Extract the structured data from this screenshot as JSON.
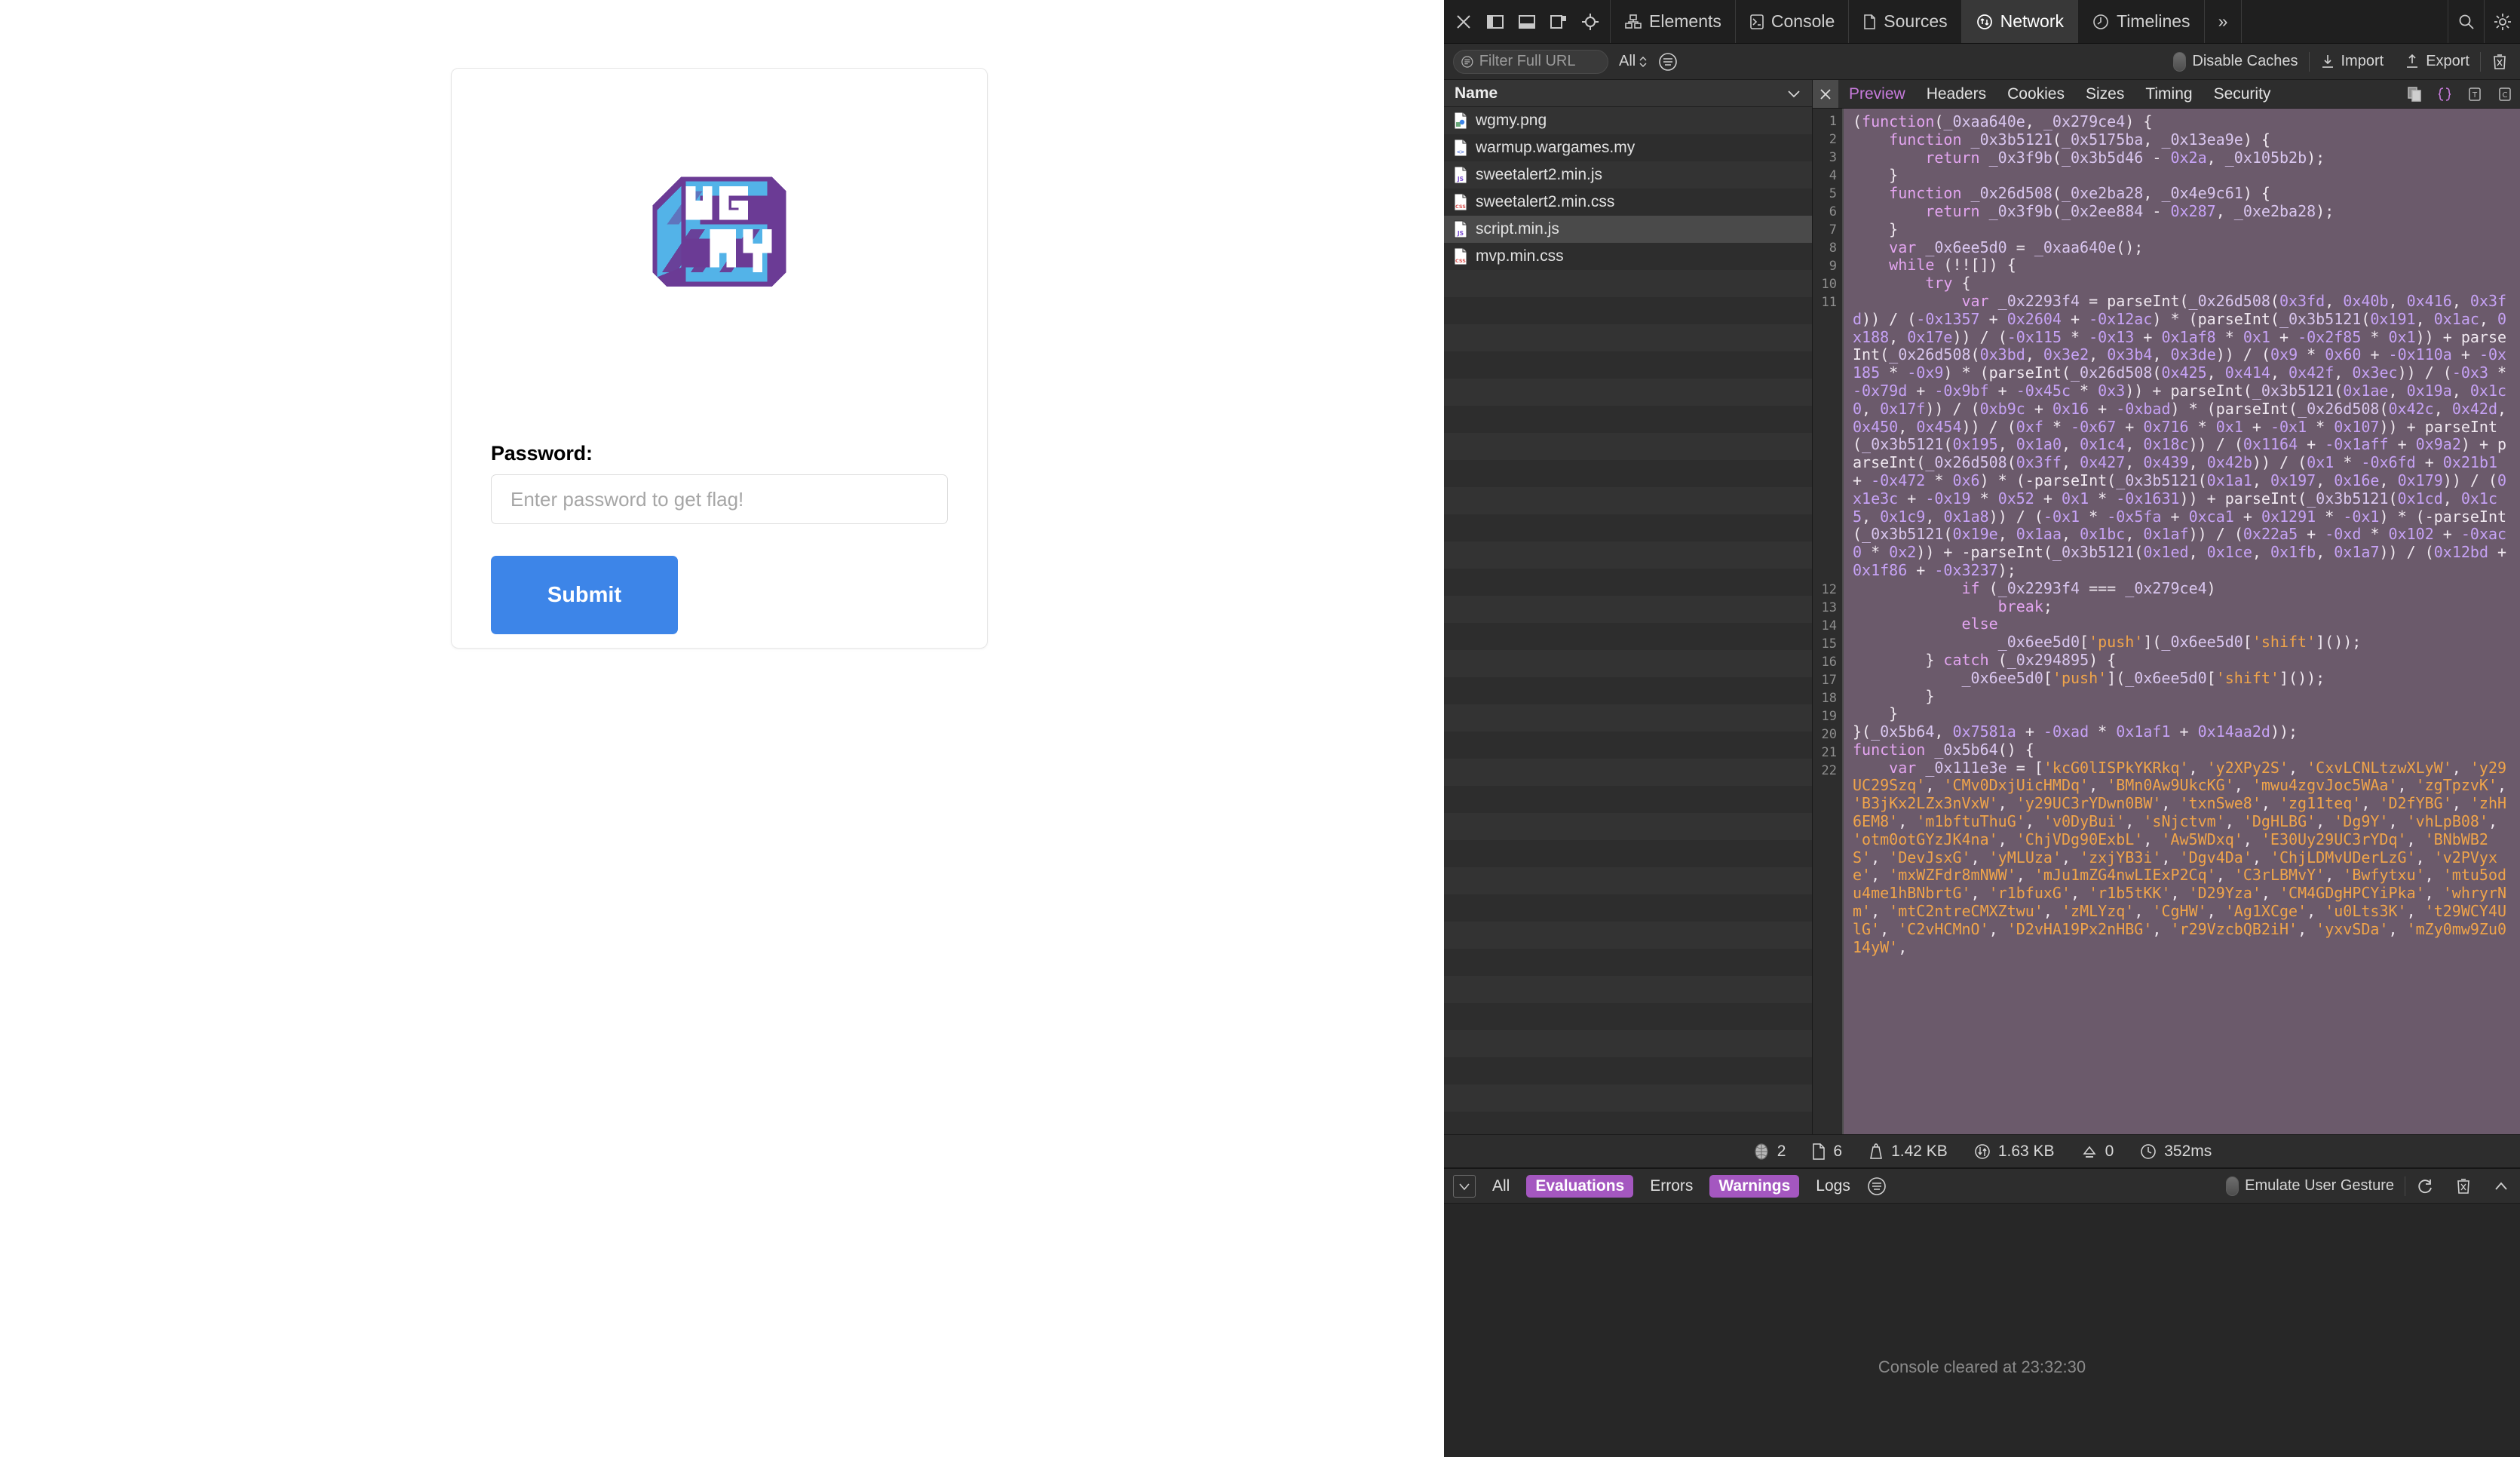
{
  "page": {
    "logo_alt": "WGMY",
    "password_label": "Password:",
    "password_placeholder": "Enter password to get flag!",
    "password_value": "",
    "submit_label": "Submit",
    "colors": {
      "submit_bg": "#3d85e8",
      "logo_blue": "#53b3e8",
      "logo_purple": "#6b3b95"
    }
  },
  "devtools": {
    "toolbar_icons": [
      "close-icon",
      "dock-left-icon",
      "dock-bottom-icon",
      "undock-icon",
      "inspect-icon"
    ],
    "tabs": [
      {
        "label": "Elements",
        "icon": "elements-icon",
        "active": false
      },
      {
        "label": "Console",
        "icon": "console-icon",
        "active": false
      },
      {
        "label": "Sources",
        "icon": "sources-icon",
        "active": false
      },
      {
        "label": "Network",
        "icon": "network-icon",
        "active": true
      },
      {
        "label": "Timelines",
        "icon": "timelines-icon",
        "active": false
      }
    ],
    "tabs_overflow": "»",
    "right_icons": [
      "search-icon",
      "settings-gear-icon"
    ],
    "filterbar": {
      "filter_placeholder": "Filter Full URL",
      "filter_value": "",
      "resource_type": "All",
      "more_filters_icon": "hamburger-circle-icon",
      "disable_caches_label": "Disable Caches",
      "disable_caches_on": false,
      "import_label": "Import",
      "export_label": "Export",
      "clear_icon": "trash-icon"
    },
    "filelist": {
      "header": "Name",
      "sort_icon": "chevron-down-icon",
      "rows": [
        {
          "name": "wgmy.png",
          "type": "png",
          "selected": false
        },
        {
          "name": "warmup.wargames.my",
          "type": "html",
          "selected": false
        },
        {
          "name": "sweetalert2.min.js",
          "type": "js",
          "selected": false
        },
        {
          "name": "sweetalert2.min.css",
          "type": "css",
          "selected": false
        },
        {
          "name": "script.min.js",
          "type": "js",
          "selected": true
        },
        {
          "name": "mvp.min.css",
          "type": "css",
          "selected": false
        }
      ]
    },
    "detail": {
      "close_icon": "close-icon",
      "tabs": [
        {
          "label": "Preview",
          "active": true
        },
        {
          "label": "Headers",
          "active": false
        },
        {
          "label": "Cookies",
          "active": false
        },
        {
          "label": "Sizes",
          "active": false
        },
        {
          "label": "Timing",
          "active": false
        },
        {
          "label": "Security",
          "active": false
        }
      ],
      "action_icons": [
        "copy-icon",
        "pretty-print-braces-icon",
        "show-text-icon",
        "show-chars-icon"
      ]
    },
    "code": {
      "line_numbers": [
        1,
        2,
        3,
        4,
        5,
        6,
        7,
        8,
        9,
        10,
        11,
        12,
        13,
        14,
        15,
        16,
        17,
        18,
        19,
        20,
        21,
        22
      ],
      "lines": [
        "(function(_0xaa640e, _0x279ce4) {",
        "    function _0x3b5121(_0x5175ba, _0x13ea9e) {",
        "        return _0x3f9b(_0x3b5d46 - 0x2a, _0x105b2b);",
        "    }",
        "    function _0x26d508(_0xe2ba28, _0x4e9c61) {",
        "        return _0x3f9b(_0x2ee884 - 0x287, _0xe2ba28);",
        "    }",
        "    var _0x6ee5d0 = _0xaa640e();",
        "    while (!![]) {",
        "        try {",
        "            var _0x2293f4 = parseInt(_0x26d508(0x3fd, 0x40b, 0x416, 0x3fd)) / (-0x1357 + 0x2604 + -0x12ac) * (parseInt(_0x3b5121(0x191, 0x1ac, 0x188, 0x17e)) / (-0x115 * -0x13 + 0x1af8 * 0x1 + -0x2f85 * 0x1)) + parseInt(_0x26d508(0x3bd, 0x3e2, 0x3b4, 0x3de)) / (0x9 * 0x60 + -0x110a + -0x185 * -0x9) * (parseInt(_0x26d508(0x425, 0x414, 0x42f, 0x3ec)) / (-0x3 * -0x79d + -0x9bf + -0x45c * 0x3)) + parseInt(_0x3b5121(0x1ae, 0x19a, 0x1c0, 0x17f)) / (0xb9c + 0x16 + -0xbad) * (parseInt(_0x26d508(0x42c, 0x42d, 0x450, 0x454)) / (0xf * -0x67 + 0x716 * 0x1 + -0x1 * 0x107)) + parseInt(_0x3b5121(0x195, 0x1a0, 0x1c4, 0x18c)) / (0x1164 + -0x1aff + 0x9a2) + parseInt(_0x26d508(0x3ff, 0x427, 0x439, 0x42b)) / (0x1 * -0x6fd + 0x21b1 + -0x472 * 0x6) * (-parseInt(_0x3b5121(0x1a1, 0x197, 0x16e, 0x179)) / (0x1e3c + -0x19 * 0x52 + 0x1 * -0x1631)) + parseInt(_0x3b5121(0x1cd, 0x1c5, 0x1c9, 0x1a8)) / (-0x1 * -0x5fa + 0xca1 + 0x1291 * -0x1) * (-parseInt(_0x3b5121(0x19e, 0x1aa, 0x1bc, 0x1af)) / (0x22a5 + -0xd * 0x102 + -0xac0 * 0x2)) + -parseInt(_0x3b5121(0x1ed, 0x1ce, 0x1fb, 0x1a7)) / (0x12bd + 0x1f86 + -0x3237);",
        "            if (_0x2293f4 === _0x279ce4)",
        "                break;",
        "            else",
        "                _0x6ee5d0['push'](_0x6ee5d0['shift']());",
        "        } catch (_0x294895) {",
        "            _0x6ee5d0['push'](_0x6ee5d0['shift']());",
        "        }",
        "    }",
        "}(_0x5b64, 0x7581a + -0xad * 0x1af1 + 0x14aa2d));",
        "function _0x5b64() {",
        "    var _0x111e3e = ['kcG0lISPkYKRkq', 'y2XPy2S', 'CxvLCNLtzwXLyW', 'y29UC29Szq', 'CMv0DxjUicHMDq', 'BMn0Aw9UkcKG', 'mwu4zgvJoc5WAa', 'zgTpzvK', 'B3jKx2LZx3nVxW', 'y29UC3rYDwn0BW', 'txnSwe8', 'zg11teq', 'D2fYBG', 'zhH6EM8', 'm1bftuThuG', 'v0DyBui', 'sNjctvm', 'DgHLBG', 'Dg9Y', 'vhLpB08', 'otm0otGYzJK4na', 'ChjVDg90ExbL', 'Aw5WDxq', 'E30Uy29UC3rYDq', 'BNbWB2S', 'DevJsxG', 'yMLUza', 'zxjYB3i', 'Dgv4Da', 'ChjLDMvUDerLzG', 'v2PVyxe', 'mxWZFdr8mNWW', 'mJu1mZG4nwLIExP2Cq', 'C3rLBMvY', 'Bwfytxu', 'mtu5odu4me1hBNbrtG', 'r1bfuxG', 'r1b5tKK', 'D29Yza', 'CM4GDgHPCYiPka', 'whryrNm', 'mtC2ntreCMXZtwu', 'zMLYzq', 'CgHW', 'Ag1XCge', 'u0Lts3K', 't29WCY4UlG', 'C2vHCMnO', 'D2vHA19Px2nHBG', 'r29VzcbQB2iH', 'yxvSDa', 'mZy0mw9Zu014yW',"
      ]
    },
    "net_status": [
      {
        "icon": "globe-icon",
        "value": "2"
      },
      {
        "icon": "document-icon",
        "value": "6"
      },
      {
        "icon": "weight-icon",
        "value": "1.42 KB"
      },
      {
        "icon": "transfer-icon",
        "value": "1.63 KB"
      },
      {
        "icon": "upload-icon",
        "value": "0"
      },
      {
        "icon": "clock-icon",
        "value": "352ms"
      }
    ],
    "console": {
      "dropdown_icon": "filter-dropdown-icon",
      "chips": [
        {
          "label": "All",
          "on": false
        },
        {
          "label": "Evaluations",
          "on": true
        },
        {
          "label": "Errors",
          "on": false
        },
        {
          "label": "Warnings",
          "on": true
        },
        {
          "label": "Logs",
          "on": false
        }
      ],
      "more_icon": "hamburger-circle-icon",
      "emulate_label": "Emulate User Gesture",
      "emulate_on": false,
      "right_icons": [
        "refresh-icon",
        "clear-console-icon",
        "collapse-icon"
      ],
      "cleared_message": "Console cleared at 23:32:30"
    }
  }
}
